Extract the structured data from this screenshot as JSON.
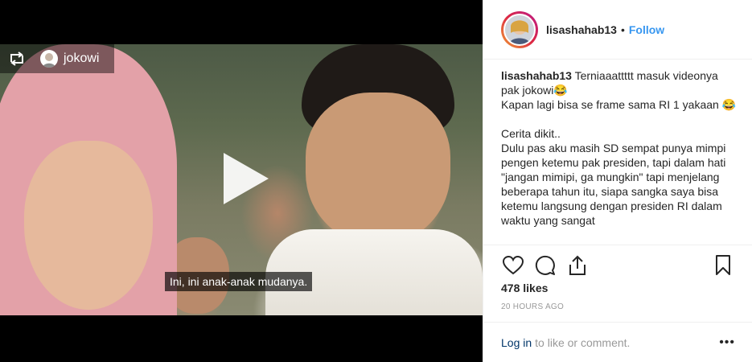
{
  "repost": {
    "username": "jokowi"
  },
  "video": {
    "caption": "Ini, ini anak-anak mudanya."
  },
  "header": {
    "username": "lisashahab13",
    "separator": "•",
    "follow_label": "Follow"
  },
  "post": {
    "username": "lisashahab13",
    "caption_text": " Terniaaattttt masuk videonya pak jokowi😂\nKapan lagi bisa se frame sama RI 1 yakaan 😂\n\nCerita dikit..\nDulu pas aku masih SD sempat punya mimpi pengen ketemu pak presiden, tapi dalam hati \"jangan mimipi, ga mungkin\" tapi menjelang beberapa tahun itu, siapa sangka saya bisa ketemu langsung dengan presiden RI dalam waktu yang sangat"
  },
  "likes": "478 likes",
  "timestamp": "20 HOURS AGO",
  "footer": {
    "login_label": "Log in",
    "rest_text": "to like or comment.",
    "more_label": "•••"
  },
  "icons": [
    "repost-icon",
    "play-icon",
    "heart-icon",
    "comment-icon",
    "share-icon",
    "bookmark-icon",
    "more-options-icon"
  ]
}
